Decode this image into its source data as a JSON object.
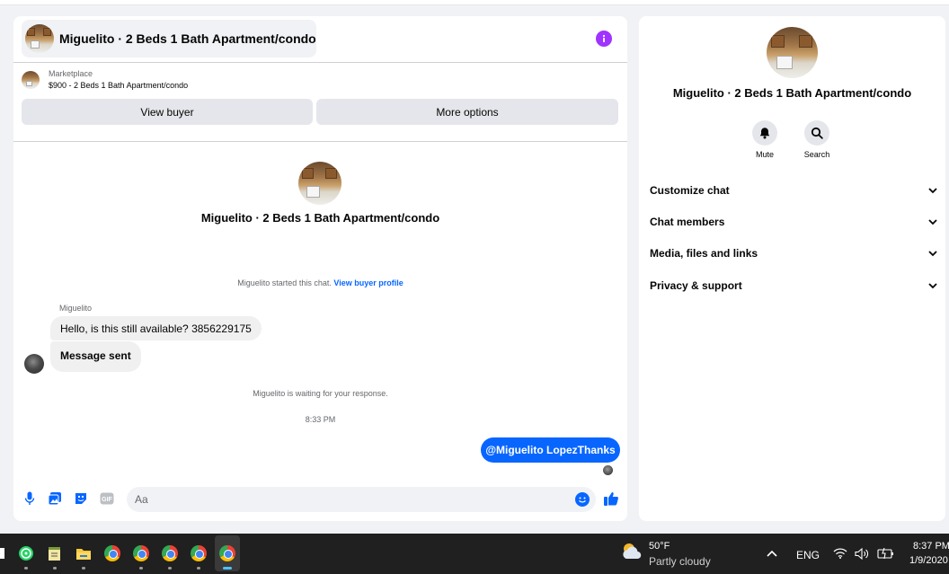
{
  "listing": {
    "title": "Miguelito · 2 Beds 1 Bath Apartment/condo"
  },
  "marketplace": {
    "label": "Marketplace",
    "subtitle": "$900 - 2 Beds 1 Bath Apartment/condo",
    "view_buyer_label": "View buyer",
    "more_options_label": "More options"
  },
  "conversation": {
    "started_text": "Miguelito started this chat.",
    "view_buyer_profile": "View buyer profile",
    "sender_name": "Miguelito",
    "messages": [
      {
        "from": "buyer",
        "text": "Hello, is this still available? 3856229175"
      },
      {
        "from": "buyer",
        "text": "Message sent"
      },
      {
        "from": "me",
        "text": "@Miguelito LopezThanks"
      }
    ],
    "waiting_text": "Miguelito is waiting for your response.",
    "timestamp": "8:33 PM"
  },
  "composer": {
    "placeholder": "Aa"
  },
  "info_panel": {
    "actions": [
      {
        "label": "Mute",
        "icon": "bell-icon"
      },
      {
        "label": "Search",
        "icon": "search-icon"
      }
    ],
    "sections": [
      {
        "label": "Customize chat"
      },
      {
        "label": "Chat members"
      },
      {
        "label": "Media, files and links"
      },
      {
        "label": "Privacy & support"
      }
    ]
  },
  "taskbar": {
    "weather_temp": "50°F",
    "weather_desc": "Partly cloudy",
    "language": "ENG",
    "time": "8:37 PM",
    "date": "1/9/2020"
  },
  "colors": {
    "accent": "#0866ff",
    "info": "#a033ff",
    "bubble_in": "#f0f0f0",
    "button_gray": "#e4e6eb",
    "taskbar": "#202020"
  }
}
